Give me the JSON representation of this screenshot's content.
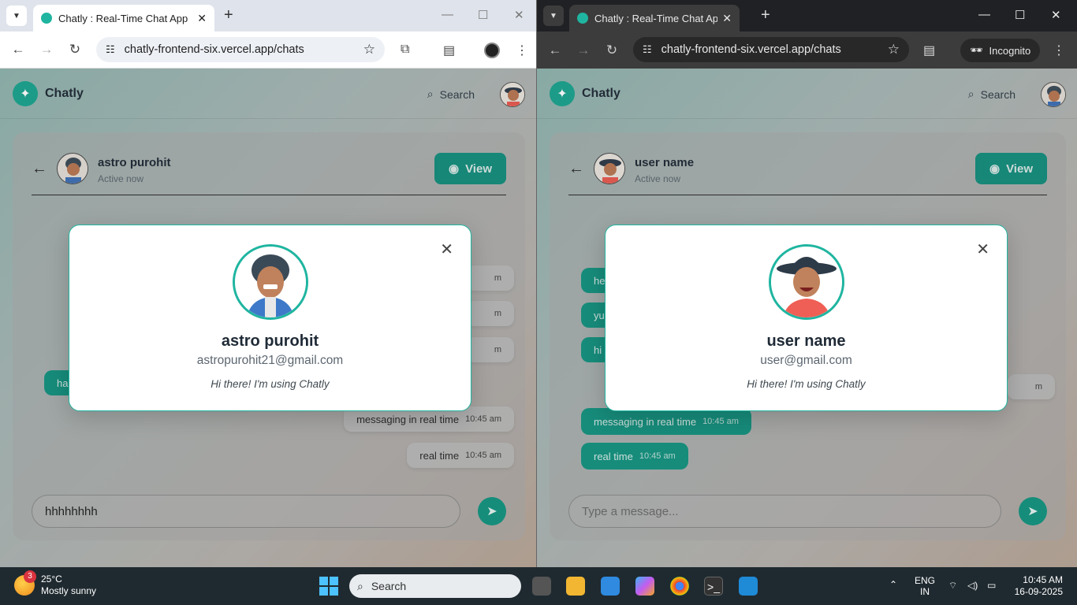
{
  "left_window": {
    "tab_title": "Chatly : Real-Time Chat App",
    "url": "chatly-frontend-six.vercel.app/chats",
    "app": {
      "brand": "Chatly",
      "search_label": "Search",
      "chat": {
        "contact_name": "astro purohit",
        "status": "Active now",
        "view_label": "View",
        "messages": [
          {
            "text": "messaging in real time",
            "time": "10:45 am"
          },
          {
            "text": "real time",
            "time": "10:45 am"
          }
        ],
        "partial_bubbles": [
          "ha",
          "m",
          "m",
          "m"
        ],
        "composer_value": "hhhhhhhh"
      },
      "modal": {
        "name": "astro purohit",
        "email": "astropurohit21@gmail.com",
        "about": "Hi there! I'm using Chatly"
      }
    }
  },
  "right_window": {
    "tab_title": "Chatly : Real-Time Chat App",
    "url": "chatly-frontend-six.vercel.app/chats",
    "incognito_label": "Incognito",
    "app": {
      "brand": "Chatly",
      "search_label": "Search",
      "chat": {
        "contact_name": "user name",
        "status": "Active now",
        "view_label": "View",
        "messages": [
          {
            "text": "messaging in real time",
            "time": "10:45 am"
          },
          {
            "text": "real time",
            "time": "10:45 am"
          }
        ],
        "partial_bubbles": [
          "he",
          "yu",
          "hi",
          "m"
        ],
        "composer_placeholder": "Type a message..."
      },
      "modal": {
        "name": "user name",
        "email": "user@gmail.com",
        "about": "Hi there! I'm using Chatly"
      }
    }
  },
  "taskbar": {
    "weather_temp": "25°C",
    "weather_desc": "Mostly sunny",
    "weather_badge": "3",
    "search_label": "Search",
    "lang_1": "ENG",
    "lang_2": "IN",
    "time": "10:45 AM",
    "date": "16-09-2025"
  },
  "colors": {
    "accent": "#1fb5a0",
    "bubble_out": "#149380"
  }
}
